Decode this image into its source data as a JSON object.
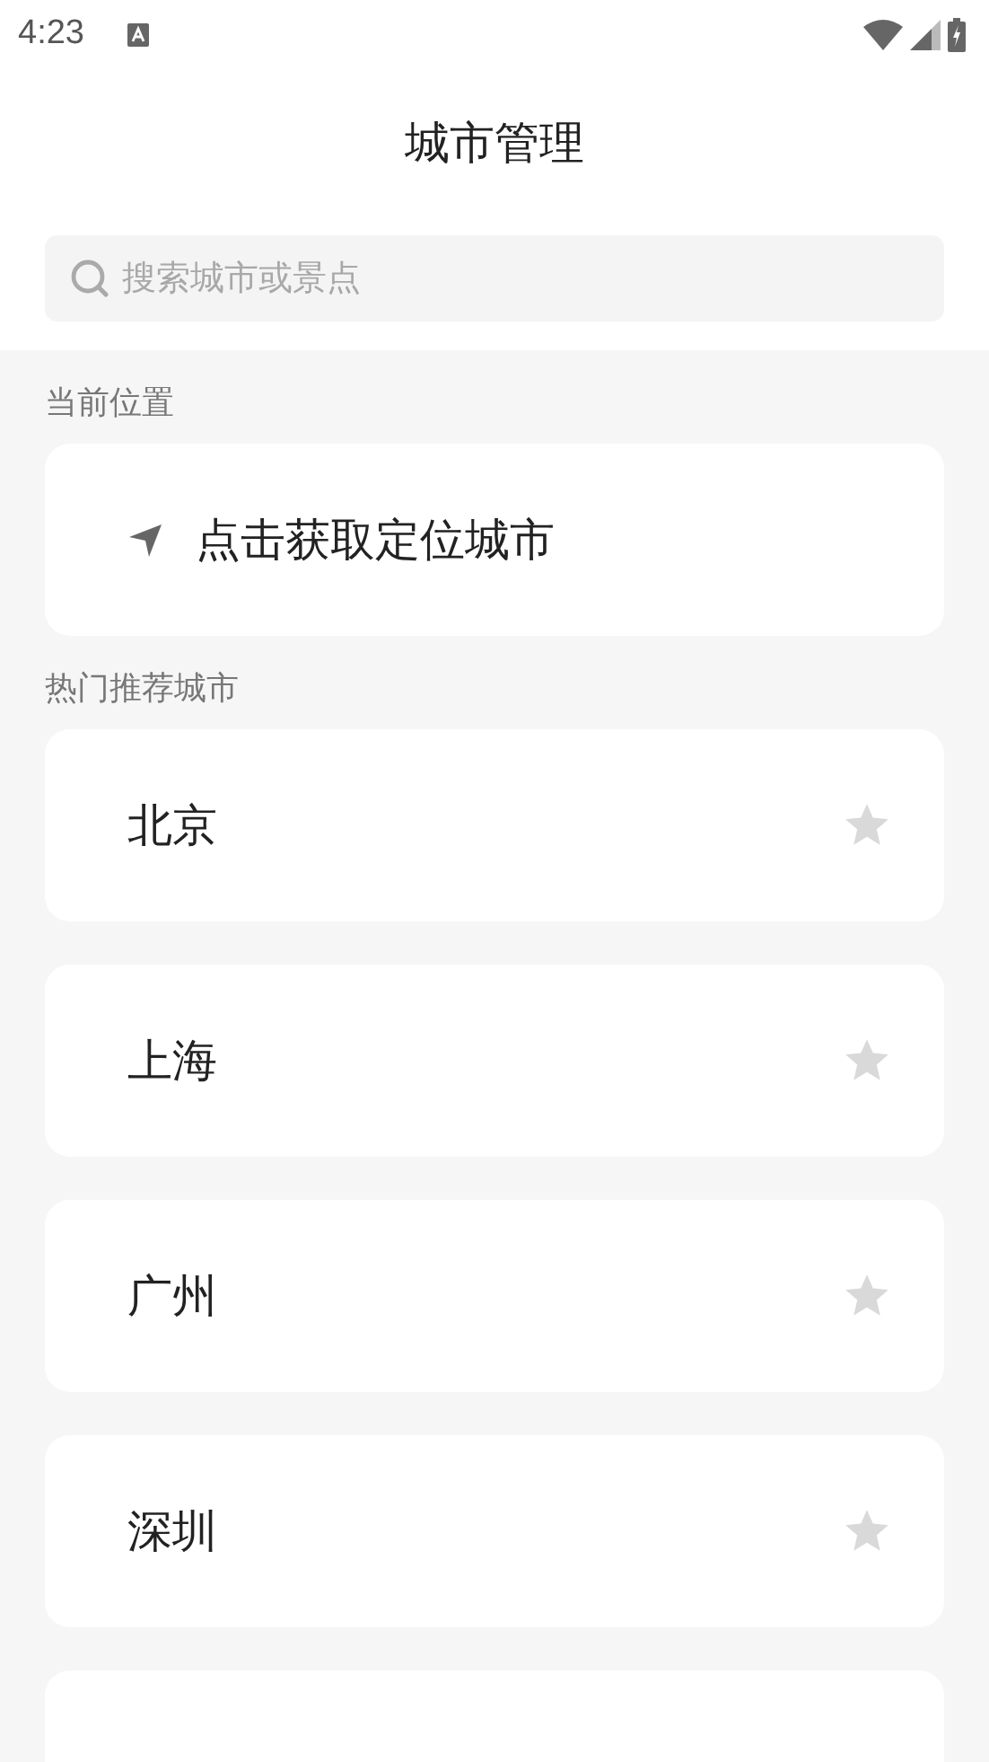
{
  "status_bar": {
    "time": "4:23"
  },
  "header": {
    "title": "城市管理"
  },
  "search": {
    "placeholder": "搜索城市或景点"
  },
  "current_location": {
    "label": "当前位置",
    "action": "点击获取定位城市"
  },
  "hot_cities": {
    "label": "热门推荐城市",
    "items": [
      {
        "name": "北京",
        "favorite": false
      },
      {
        "name": "上海",
        "favorite": false
      },
      {
        "name": "广州",
        "favorite": false
      },
      {
        "name": "深圳",
        "favorite": false
      }
    ]
  }
}
